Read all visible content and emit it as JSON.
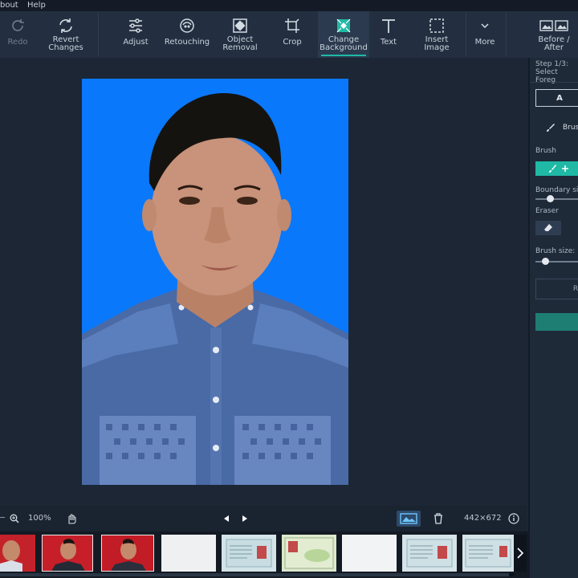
{
  "menu": {
    "about": "bout",
    "help": "Help"
  },
  "toolbar": {
    "redo": "Redo",
    "revert": "Revert\nChanges",
    "adjust": "Adjust",
    "retouching": "Retouching",
    "object_removal": "Object\nRemoval",
    "crop": "Crop",
    "change_background": "Change\nBackground",
    "text": "Text",
    "insert_image": "Insert\nImage",
    "more": "More",
    "before_after": "Before /\nAfter"
  },
  "panel": {
    "step_line1": "Step 1/3:",
    "step_line2": "Select Foreg",
    "auto_btn": "A",
    "brush_tab": "Brus",
    "brush_label": "Brush",
    "boundary_label": "Boundary si",
    "eraser_label": "Eraser",
    "brush_size_label": "Brush size:",
    "reset_btn": "R",
    "boundary_level": 0.3,
    "brush_size_level": 0.2
  },
  "status": {
    "zoom": "100%",
    "dimensions": "442×672"
  },
  "colors": {
    "accent": "#1fb9a5",
    "photo_background": "#0a78fa"
  }
}
